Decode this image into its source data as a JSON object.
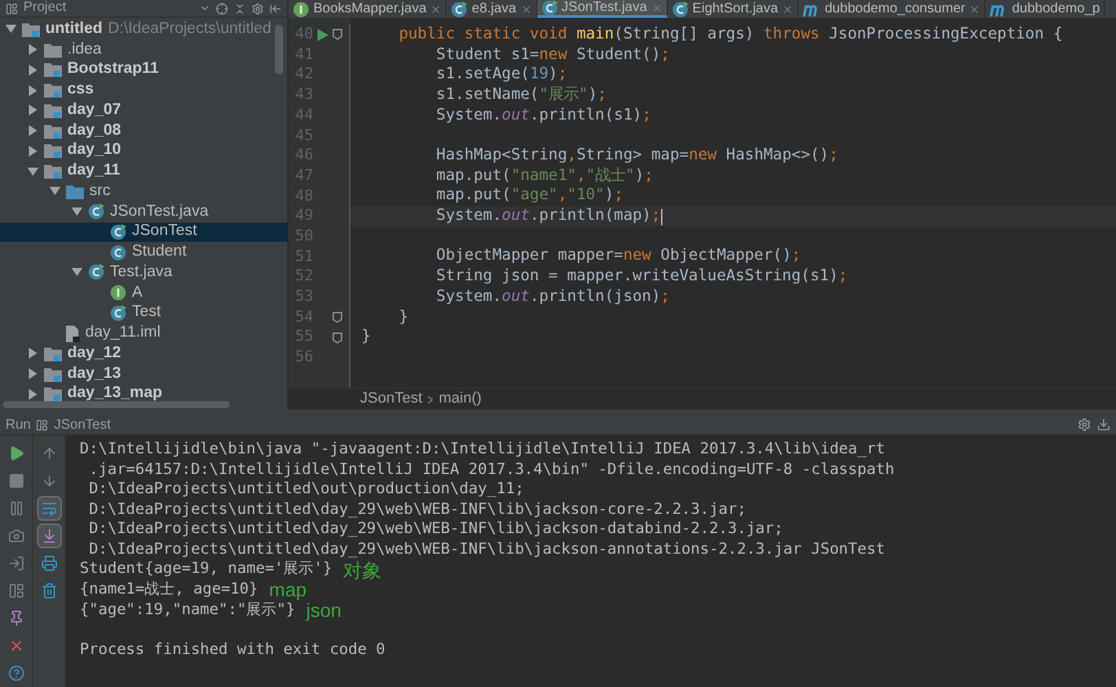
{
  "project_panel": {
    "title": "Project"
  },
  "tree": [
    {
      "label": "untitled",
      "path": "D:\\IdeaProjects\\untitled",
      "kind": "module",
      "expanded": true,
      "selected": false,
      "children": [
        {
          "label": ".idea",
          "kind": "folder",
          "expanded": false,
          "selected": false
        },
        {
          "label": "Bootstrap11",
          "kind": "module",
          "expanded": false,
          "selected": false
        },
        {
          "label": "css",
          "kind": "module",
          "expanded": false,
          "selected": false
        },
        {
          "label": "day_07",
          "kind": "module",
          "expanded": false,
          "selected": false
        },
        {
          "label": "day_08",
          "kind": "module",
          "expanded": false,
          "selected": false
        },
        {
          "label": "day_10",
          "kind": "module",
          "expanded": false,
          "selected": false
        },
        {
          "label": "day_11",
          "kind": "module",
          "expanded": true,
          "selected": false,
          "children": [
            {
              "label": "src",
              "kind": "source",
              "expanded": true,
              "selected": false,
              "children": [
                {
                  "label": "JSonTest.java",
                  "kind": "runclass",
                  "expanded": true,
                  "selected": false,
                  "children": [
                    {
                      "label": "JSonTest",
                      "kind": "runclass",
                      "selected": true
                    },
                    {
                      "label": "Student",
                      "kind": "class",
                      "selected": false
                    }
                  ]
                },
                {
                  "label": "Test.java",
                  "kind": "runclass",
                  "expanded": true,
                  "selected": false,
                  "children": [
                    {
                      "label": "A",
                      "kind": "interface",
                      "selected": false
                    },
                    {
                      "label": "Test",
                      "kind": "runclass",
                      "selected": false
                    }
                  ]
                }
              ]
            },
            {
              "label": "day_11.iml",
              "kind": "file",
              "selected": false
            }
          ]
        },
        {
          "label": "day_12",
          "kind": "module",
          "expanded": false,
          "selected": false
        },
        {
          "label": "day_13",
          "kind": "module",
          "expanded": false,
          "selected": false
        },
        {
          "label": "day_13_map",
          "kind": "module",
          "expanded": false,
          "selected": false
        }
      ]
    }
  ],
  "tabs": [
    {
      "label": "BooksMapper.java",
      "kind": "interface",
      "selected": false
    },
    {
      "label": "e8.java",
      "kind": "runclass",
      "selected": false
    },
    {
      "label": "JSonTest.java",
      "kind": "runclass",
      "selected": true
    },
    {
      "label": "EightSort.java",
      "kind": "runclass",
      "selected": false
    },
    {
      "label": "dubbodemo_consumer",
      "kind": "maven",
      "selected": false
    },
    {
      "label": "dubbodemo_p",
      "kind": "maven",
      "selected": false
    }
  ],
  "code": [
    {
      "number": "40",
      "run": true,
      "fold": true,
      "current": false,
      "tokens": [
        {
          "kind": "keyword",
          "text": "    public static void "
        },
        {
          "kind": "method",
          "text": "main"
        },
        {
          "kind": "plain",
          "text": "(String[] args) "
        },
        {
          "kind": "keyword",
          "text": "throws "
        },
        {
          "kind": "plain",
          "text": "JsonProcessingException {"
        }
      ]
    },
    {
      "number": "41",
      "run": false,
      "fold": false,
      "current": false,
      "tokens": [
        {
          "kind": "plain",
          "text": "        Student s1="
        },
        {
          "kind": "keyword",
          "text": "new "
        },
        {
          "kind": "plain",
          "text": "Student()"
        },
        {
          "kind": "keyword",
          "text": ";"
        }
      ]
    },
    {
      "number": "42",
      "run": false,
      "fold": false,
      "current": false,
      "tokens": [
        {
          "kind": "plain",
          "text": "        s1.setAge("
        },
        {
          "kind": "number",
          "text": "19"
        },
        {
          "kind": "plain",
          "text": ")"
        },
        {
          "kind": "keyword",
          "text": ";"
        }
      ]
    },
    {
      "number": "43",
      "run": false,
      "fold": false,
      "current": false,
      "tokens": [
        {
          "kind": "plain",
          "text": "        s1.setName("
        },
        {
          "kind": "string",
          "text": "\"展示\""
        },
        {
          "kind": "plain",
          "text": ")"
        },
        {
          "kind": "keyword",
          "text": ";"
        }
      ]
    },
    {
      "number": "44",
      "run": false,
      "fold": false,
      "current": false,
      "tokens": [
        {
          "kind": "plain",
          "text": "        System."
        },
        {
          "kind": "field",
          "text": "out"
        },
        {
          "kind": "plain",
          "text": ".println(s1)"
        },
        {
          "kind": "keyword",
          "text": ";"
        }
      ]
    },
    {
      "number": "45",
      "run": false,
      "fold": false,
      "current": false
    },
    {
      "number": "46",
      "run": false,
      "fold": false,
      "current": false,
      "tokens": [
        {
          "kind": "plain",
          "text": "        HashMap<String"
        },
        {
          "kind": "keyword",
          "text": ","
        },
        {
          "kind": "plain",
          "text": "String> map="
        },
        {
          "kind": "keyword",
          "text": "new "
        },
        {
          "kind": "plain",
          "text": "HashMap<>()"
        },
        {
          "kind": "keyword",
          "text": ";"
        }
      ]
    },
    {
      "number": "47",
      "run": false,
      "fold": false,
      "current": false,
      "tokens": [
        {
          "kind": "plain",
          "text": "        map.put("
        },
        {
          "kind": "string",
          "text": "\"name1\""
        },
        {
          "kind": "keyword",
          "text": ","
        },
        {
          "kind": "string",
          "text": "\"战士\""
        },
        {
          "kind": "plain",
          "text": ")"
        },
        {
          "kind": "keyword",
          "text": ";"
        }
      ]
    },
    {
      "number": "48",
      "run": false,
      "fold": false,
      "current": false,
      "tokens": [
        {
          "kind": "plain",
          "text": "        map.put("
        },
        {
          "kind": "string",
          "text": "\"age\""
        },
        {
          "kind": "keyword",
          "text": ","
        },
        {
          "kind": "string",
          "text": "\"10\""
        },
        {
          "kind": "plain",
          "text": ")"
        },
        {
          "kind": "keyword",
          "text": ";"
        }
      ]
    },
    {
      "number": "49",
      "run": false,
      "fold": false,
      "current": true,
      "tokens": [
        {
          "kind": "plain",
          "text": "        System."
        },
        {
          "kind": "field",
          "text": "out"
        },
        {
          "kind": "plain",
          "text": ".println(map)"
        },
        {
          "kind": "keyword",
          "text": ";"
        }
      ]
    },
    {
      "number": "50",
      "run": false,
      "fold": false,
      "current": false
    },
    {
      "number": "51",
      "run": false,
      "fold": false,
      "current": false,
      "tokens": [
        {
          "kind": "plain",
          "text": "        ObjectMapper mapper="
        },
        {
          "kind": "keyword",
          "text": "new "
        },
        {
          "kind": "plain",
          "text": "ObjectMapper()"
        },
        {
          "kind": "keyword",
          "text": ";"
        }
      ]
    },
    {
      "number": "52",
      "run": false,
      "fold": false,
      "current": false,
      "tokens": [
        {
          "kind": "plain",
          "text": "        String json = mapper.writeValueAsString(s1)"
        },
        {
          "kind": "keyword",
          "text": ";"
        }
      ]
    },
    {
      "number": "53",
      "run": false,
      "fold": false,
      "current": false,
      "tokens": [
        {
          "kind": "plain",
          "text": "        System."
        },
        {
          "kind": "field",
          "text": "out"
        },
        {
          "kind": "plain",
          "text": ".println(json)"
        },
        {
          "kind": "keyword",
          "text": ";"
        }
      ]
    },
    {
      "number": "54",
      "run": false,
      "fold": true,
      "current": false,
      "tokens": [
        {
          "kind": "plain",
          "text": "    }"
        }
      ]
    },
    {
      "number": "55",
      "run": false,
      "fold": true,
      "current": false,
      "tokens": [
        {
          "kind": "plain",
          "text": "}"
        }
      ]
    },
    {
      "number": "56",
      "run": false,
      "fold": false,
      "current": false
    }
  ],
  "breadcrumb": [
    "JSonTest",
    "main()"
  ],
  "run_panel": {
    "label": "Run",
    "tab": "JSonTest"
  },
  "run_tools": [
    {
      "kind": "run",
      "on": false
    },
    {
      "kind": "stop",
      "on": false
    },
    {
      "kind": "pause",
      "on": false
    },
    {
      "kind": "dump",
      "on": false
    },
    {
      "kind": "exit",
      "on": false
    },
    {
      "kind": "layout",
      "on": false
    },
    {
      "kind": "pin",
      "on": false
    },
    {
      "kind": "close",
      "on": false
    },
    {
      "kind": "help",
      "on": false
    }
  ],
  "output_tools": [
    {
      "kind": "up",
      "on": false
    },
    {
      "kind": "down",
      "on": false
    },
    {
      "kind": "wrap",
      "on": true
    },
    {
      "kind": "scroll",
      "on": true
    },
    {
      "kind": "print",
      "on": false
    },
    {
      "kind": "trash",
      "on": false
    }
  ],
  "console": [
    {
      "text": "D:\\Intellijidle\\bin\\java \"-javaagent:D:\\Intellijidle\\IntelliJ IDEA 2017.3.4\\lib\\idea_rt"
    },
    {
      "text": " .jar=64157:D:\\Intellijidle\\IntelliJ IDEA 2017.3.4\\bin\" -Dfile.encoding=UTF-8 -classpath"
    },
    {
      "text": " D:\\IdeaProjects\\untitled\\out\\production\\day_11;"
    },
    {
      "text": " D:\\IdeaProjects\\untitled\\day_29\\web\\WEB-INF\\lib\\jackson-core-2.2.3.jar;"
    },
    {
      "text": " D:\\IdeaProjects\\untitled\\day_29\\web\\WEB-INF\\lib\\jackson-databind-2.2.3.jar;"
    },
    {
      "text": " D:\\IdeaProjects\\untitled\\day_29\\web\\WEB-INF\\lib\\jackson-annotations-2.2.3.jar JSonTest"
    },
    {
      "text": "Student{age=19, name='展示'}",
      "note": "对象"
    },
    {
      "text": "{name1=战士, age=10}",
      "note": "map"
    },
    {
      "text": "{\"age\":19,\"name\":\"展示\"}",
      "note": "json"
    }
  ],
  "exit_message": "Process finished with exit code 0"
}
